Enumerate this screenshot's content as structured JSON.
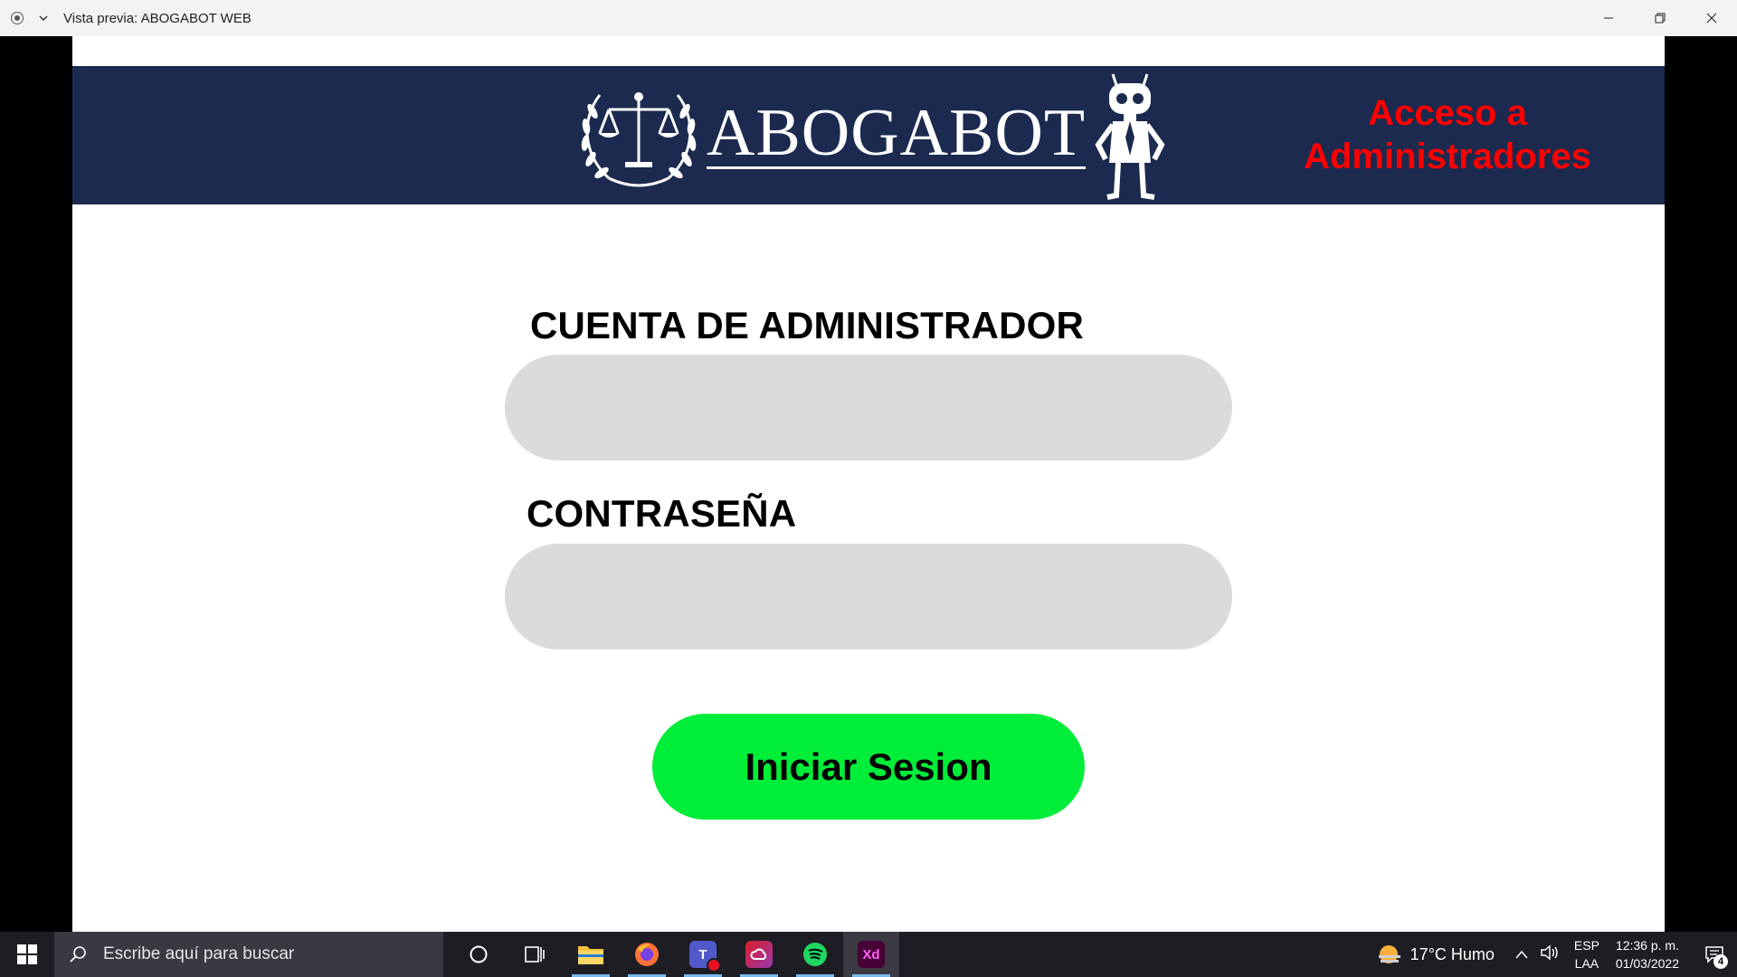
{
  "window": {
    "title": "Vista previa: ABOGABOT WEB"
  },
  "header": {
    "logo_text": "ABOGABOT",
    "admin_access": "Acceso a Administradores"
  },
  "form": {
    "account_label": "CUENTA DE ADMINISTRADOR",
    "account_value": "",
    "password_label": "CONTRASEÑA",
    "password_value": "",
    "submit_label": "Iniciar Sesion"
  },
  "taskbar": {
    "search_placeholder": "Escribe aquí para buscar",
    "weather": "17°C  Humo",
    "language_top": "ESP",
    "language_bottom": "LAA",
    "time": "12:36 p. m.",
    "date": "01/03/2022",
    "notification_count": "4",
    "apps": [
      "cortana-icon",
      "task-view-icon",
      "file-explorer-icon",
      "firefox-icon",
      "teams-icon",
      "creative-cloud-icon",
      "spotify-icon",
      "adobe-xd-icon"
    ]
  },
  "colors": {
    "header_bg": "#1b2a4e",
    "admin_text": "#ff0000",
    "input_bg": "#dcdbdc",
    "button_bg": "#00ee3a"
  }
}
